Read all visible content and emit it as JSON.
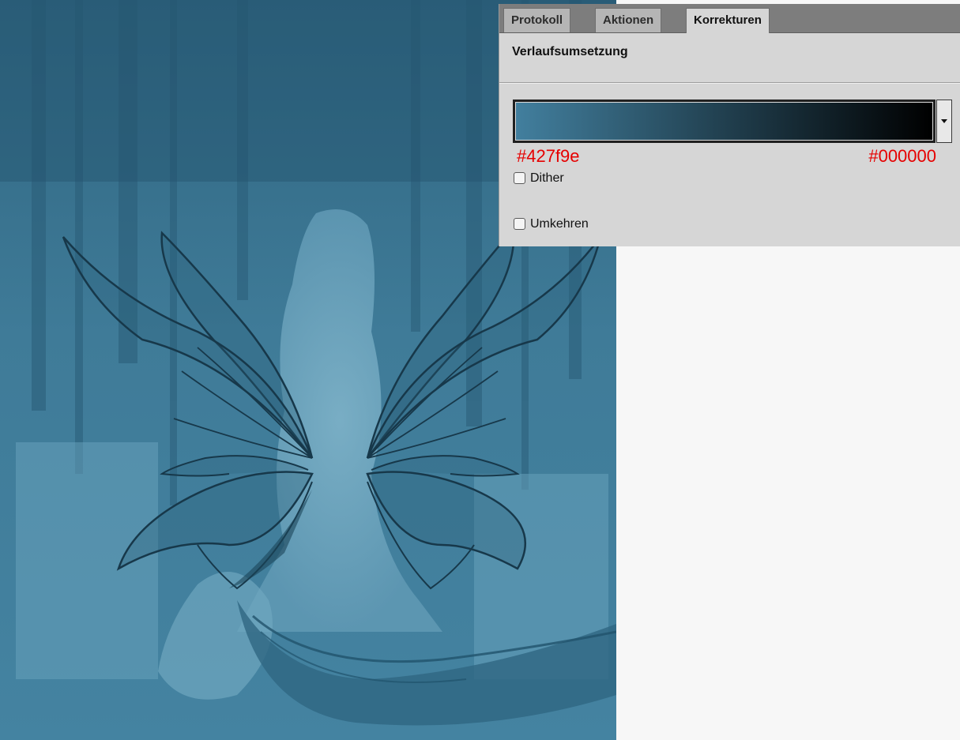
{
  "panel": {
    "tabs": [
      {
        "label": "Protokoll",
        "active": false
      },
      {
        "label": "Aktionen",
        "active": false
      },
      {
        "label": "Korrekturen",
        "active": true
      }
    ],
    "section_title": "Verlaufsumsetzung",
    "gradient": {
      "start_color": "#427f9e",
      "end_color": "#000000",
      "start_label": "#427f9e",
      "end_label": "#000000"
    },
    "options": {
      "dither": {
        "label": "Dither",
        "checked": false
      },
      "reverse": {
        "label": "Umkehren",
        "checked": false
      }
    }
  },
  "canvas": {
    "tint_color": "#3f7a97",
    "icon": "fairy-wings-image"
  }
}
